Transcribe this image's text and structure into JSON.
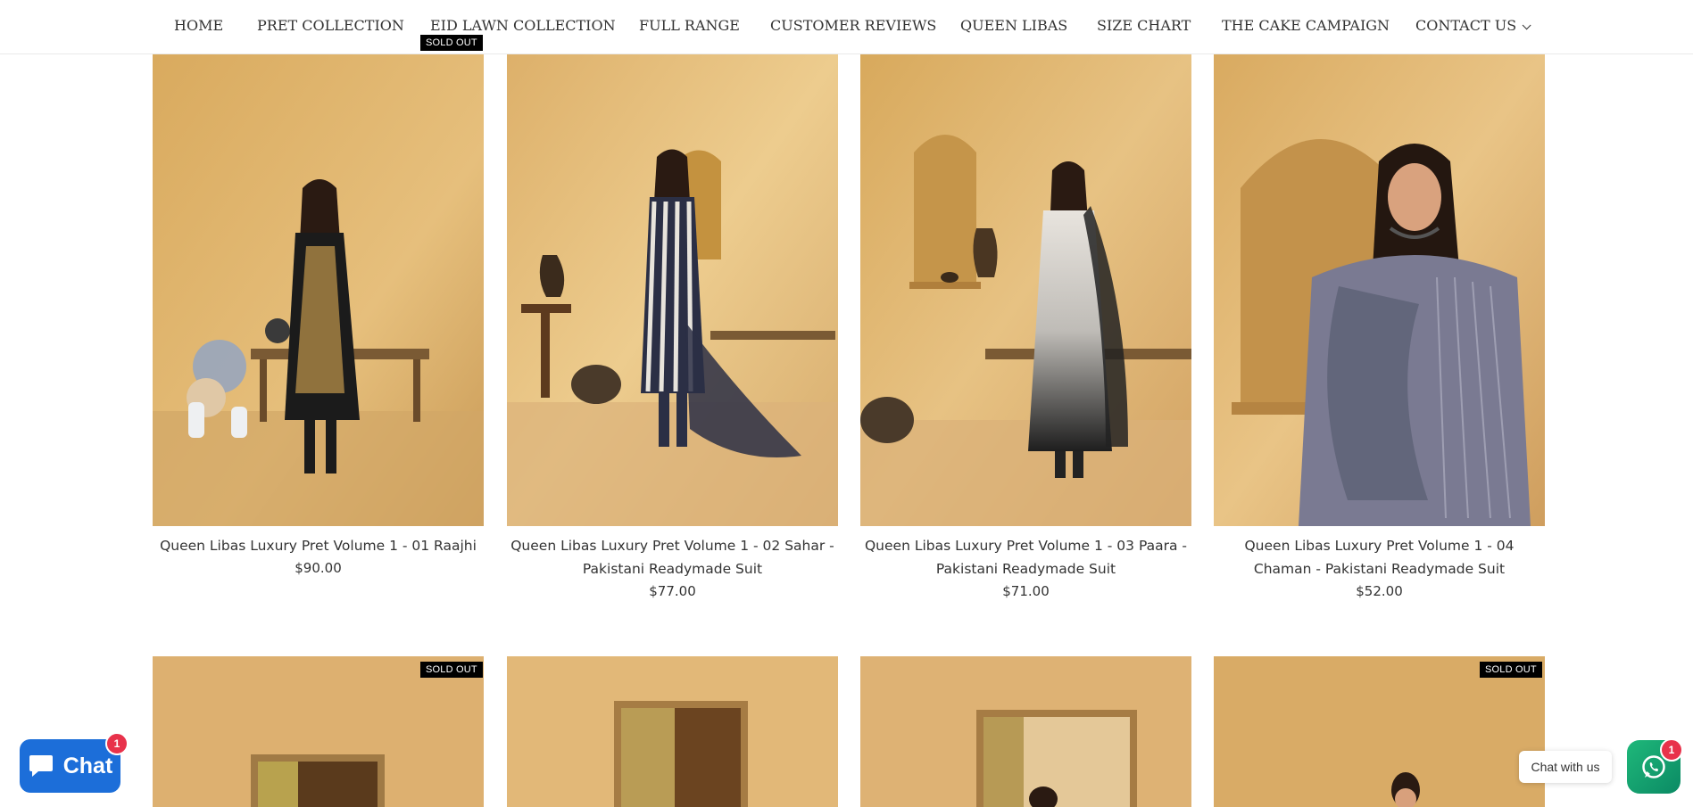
{
  "nav": {
    "items": [
      {
        "label": "HOME"
      },
      {
        "label": "PRET COLLECTION"
      },
      {
        "label": "EID LAWN COLLECTION"
      },
      {
        "label": "FULL RANGE"
      },
      {
        "label": "CUSTOMER REVIEWS"
      },
      {
        "label": "QUEEN LIBAS"
      },
      {
        "label": "SIZE CHART"
      },
      {
        "label": "THE CAKE CAMPAIGN"
      },
      {
        "label": "CONTACT US"
      }
    ]
  },
  "products": [
    {
      "title": "Queen Libas Luxury Pret Volume 1 - 01 Raajhi",
      "price": "$90.00",
      "badge": "SOLD OUT",
      "outfit_color": "#1b1b1b",
      "accent_color": "#b8904a"
    },
    {
      "title": "Queen Libas Luxury Pret Volume 1 - 02 Sahar - Pakistani Readymade Suit",
      "price": "$77.00",
      "outfit_color": "#2b2f45",
      "accent_color": "#e8e4dc"
    },
    {
      "title": "Queen Libas Luxury Pret Volume 1 - 03 Paara - Pakistani Readymade Suit",
      "price": "$71.00",
      "outfit_color": "#d9d6d0",
      "accent_color": "#222222"
    },
    {
      "title": "Queen Libas Luxury Pret Volume 1 - 04 Chaman - Pakistani Readymade Suit",
      "price": "$52.00",
      "outfit_color": "#7a7a92",
      "accent_color": "#5c6275"
    },
    {
      "badge": "SOLD OUT"
    },
    {},
    {},
    {
      "badge": "SOLD OUT"
    }
  ],
  "chat": {
    "shopify_label": "Chat",
    "shopify_badge": "1",
    "whatsapp_tooltip": "Chat with us",
    "whatsapp_badge": "1"
  },
  "colors": {
    "shopify_chat": "#1c6ed9",
    "whatsapp": "#1fb87a",
    "badge": "#000000",
    "notify": "#e8324b"
  }
}
